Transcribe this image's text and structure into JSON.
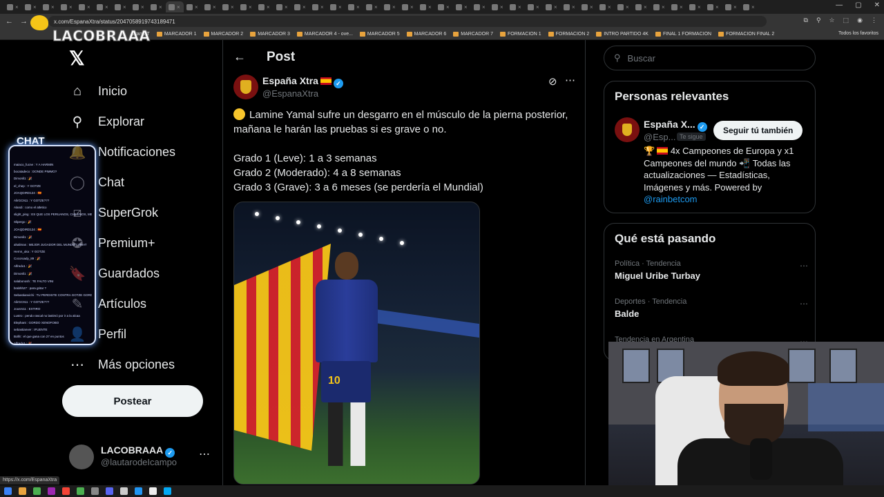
{
  "browser": {
    "url": "x.com/EspanaXtra/status/2047058919743189471",
    "bookmarks": [
      "Gran DT",
      "MARCADOR 1",
      "MARCADOR 2",
      "MARCADOR 3",
      "MARCADOR 4 - ove...",
      "MARCADOR 5",
      "MARCADOR 6",
      "MARCADOR 7",
      "FORMACION 1",
      "FORMACION 2",
      "INTRO PARTIDO 4K",
      "FINAL 1 FORMACION",
      "FORMACION FINAL 2"
    ],
    "bookmarks_right": "Todos los favoritos",
    "status_url": "https://x.com/EspanaXtra"
  },
  "overlay": {
    "logo_text": "LACOBRAAA",
    "chat_title": "CHAT",
    "chat_lines": [
      "maiaco_fucne : Y A HARMIN",
      "bocatadeco : DONDE PIMMO?",
      "Dimonli1 : 🎉",
      "el_chep : Y GOTZE",
      "JOAQDIRD124 : 🇪🇸",
      "AlirGC911 : Y GOTZE???",
      "Alandi : como el atletico",
      "slight_ping : ES QUE LOS PERUANOS, CHILENOS, MEXICANOS QUE VALEN VERGA EN EL MUNDIAL, NO LES INTERESA 🇪🇸 ES QUE LOS PERUANOS, CHILENOS, MEXICANOS QUE VALEN VERGA EN EL MUNDIAL, NO LES INTERESA 🇪🇸",
      "Slipergo : 🎉",
      "JOAQDIRD124 : 🇪🇸",
      "Dimonli1 : 🎉",
      "ahalimas : MEJOR JUGADOR DEL MUNDO? WHAT",
      "Hernn_uka : Y GOTZE",
      "Cocoroady_89 : 🎉",
      "Alfredo1 : 🎉",
      "Dimonli1 : 🎉",
      "salabonosh : TE FALTO VINI",
      "brabhh27 : para gritar ?",
      "Sebastianvichi : TU PERDISTE CONTRA GOTZE GORDITO",
      "AlirGC911 : Y GOTZE???",
      "Jousrs11 : EXTIRO",
      "Lustro : pendo rascal no lastimó por ir a la alcaa",
      "Elephant : GORDO XENOFOBO",
      "sebastianver : IFUENTE",
      "Bollit : el que gana con 27 en puntos",
      "Alfredo1 : 🎉"
    ]
  },
  "leftnav": {
    "items": [
      {
        "label": "Inicio",
        "icon": "home-icon",
        "glyph": "⌂"
      },
      {
        "label": "Explorar",
        "icon": "search-icon",
        "glyph": "⚲"
      },
      {
        "label": "Notificaciones",
        "icon": "bell-icon",
        "glyph": "🔔"
      },
      {
        "label": "Chat",
        "icon": "chat-icon",
        "glyph": "◯"
      },
      {
        "label": "SuperGrok",
        "icon": "grok-icon",
        "glyph": "⧄"
      },
      {
        "label": "Premium+",
        "icon": "premium-icon",
        "glyph": "✪"
      },
      {
        "label": "Guardados",
        "icon": "bookmark-icon",
        "glyph": "🔖"
      },
      {
        "label": "Artículos",
        "icon": "articles-icon",
        "glyph": "✎"
      },
      {
        "label": "Perfil",
        "icon": "profile-icon",
        "glyph": "👤"
      },
      {
        "label": "Más opciones",
        "icon": "more-options-icon",
        "glyph": "⋯"
      }
    ],
    "post_button": "Postear",
    "account": {
      "name": "LACOBRAAA",
      "handle": "@lautarodeIcampo"
    }
  },
  "main": {
    "title": "Post",
    "author": {
      "name": "España Xtra",
      "handle": "@EspanaXtra"
    },
    "text": {
      "line1": "Lamine Yamal sufre un desgarro en el músculo de la pierna posterior, mañana le harán las pruebas si es grave o no.",
      "grado1": "Grado 1 (Leve): 1 a 3 semanas",
      "grado2": "Grado 2 (Moderado): 4 a 8 semanas",
      "grado3": "Grado 3 (Grave): 3 a 6 meses (se perdería el Mundial)"
    },
    "image": {
      "jersey_number": "10"
    }
  },
  "right": {
    "search_placeholder": "Buscar",
    "relevant": {
      "title": "Personas relevantes",
      "name": "España X...",
      "handle": "@Esp...",
      "follows_you": "Te sigue",
      "follow_button": "Seguir tú también",
      "bio_prefix": "4x Campeones de Europa y x1 Campeones del mundo",
      "bio_rest": "Todas las actualizaciones — Estadísticas, Imágenes y más. Powered by",
      "bio_link": "@rainbetcom"
    },
    "trends": {
      "title": "Qué está pasando",
      "items": [
        {
          "meta": "Política · Tendencia",
          "name": "Miguel Uribe Turbay"
        },
        {
          "meta": "Deportes · Tendencia",
          "name": "Balde"
        },
        {
          "meta": "Tendencia en Argentina",
          "name": ""
        }
      ]
    }
  },
  "colors": {
    "accent": "#1d9bf0",
    "background": "#000000",
    "border": "#2f3336",
    "muted": "#71767b"
  }
}
